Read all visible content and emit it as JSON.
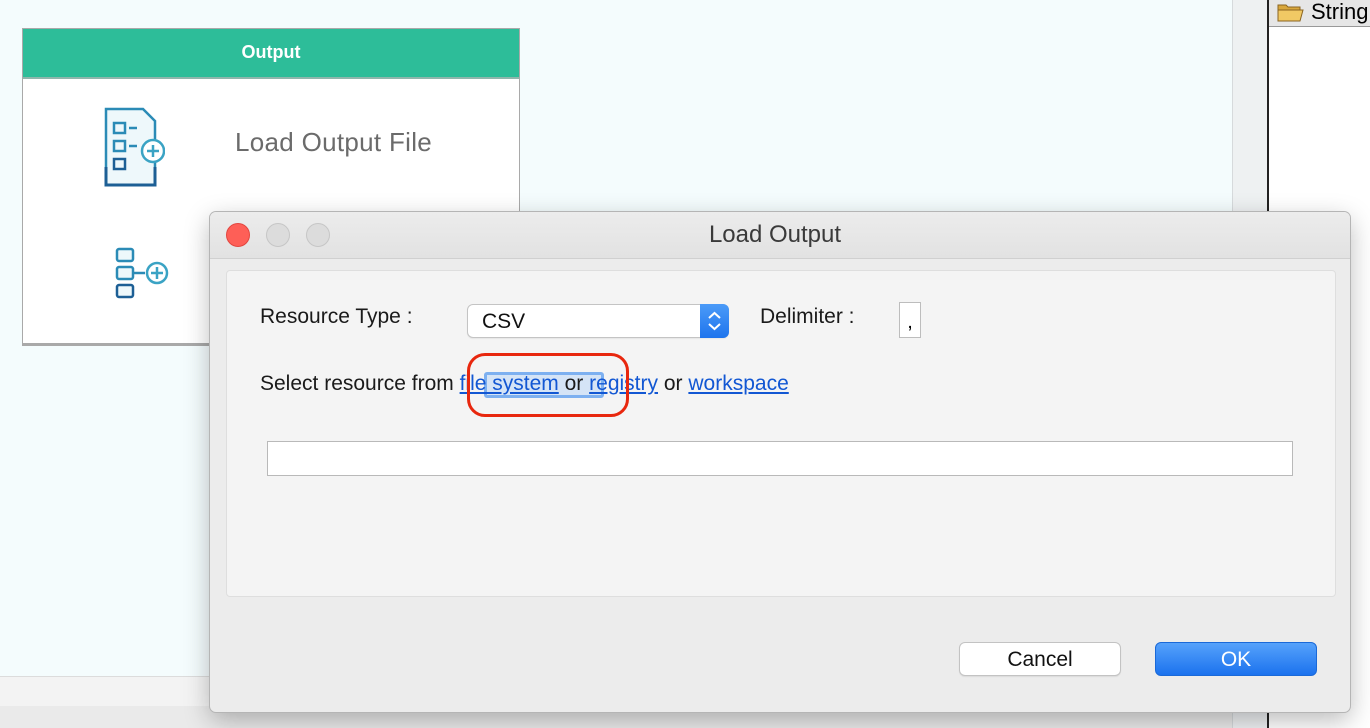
{
  "right_panel": {
    "label": "String"
  },
  "palette": {
    "header": "Output",
    "items": [
      {
        "label": "Load Output File",
        "icon": "load-output-file-icon"
      },
      {
        "label": "",
        "icon": "output-mapping-icon"
      }
    ]
  },
  "dialog": {
    "title": "Load Output",
    "resource_type_label": "Resource Type  :",
    "resource_type_value": "CSV",
    "delimiter_label": "Delimiter  :",
    "delimiter_value": ",",
    "select_prefix": "Select resource from",
    "link_file_system": "file system",
    "or1": "or",
    "link_registry": "registry",
    "or2": "or",
    "link_workspace": "workspace",
    "path_value": "",
    "cancel_label": "Cancel",
    "ok_label": "OK"
  },
  "colors": {
    "palette_header": "#2dbd99",
    "link": "#1257d3",
    "ok_button": "#2a7ff2",
    "close_button": "#fe5f57",
    "annotation": "#e8270e"
  }
}
